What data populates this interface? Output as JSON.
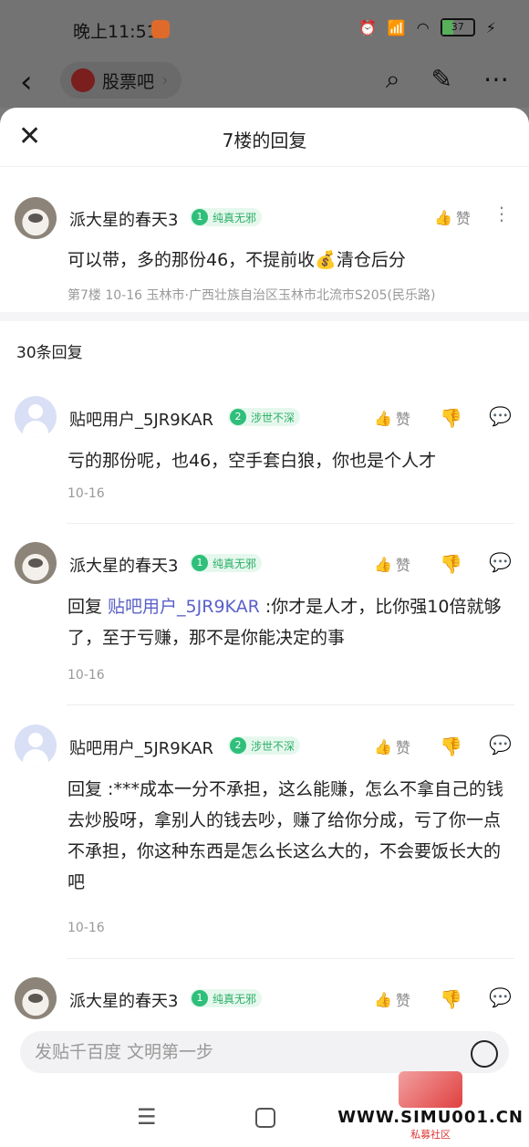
{
  "status": {
    "time": "晚上11:51",
    "battery": "37"
  },
  "nav": {
    "forum": "股票吧"
  },
  "sheet": {
    "title": "7楼的回复"
  },
  "floor": {
    "user": "派大星的春天3",
    "level": "1",
    "badge": "纯真无邪",
    "content": "可以带，多的那份46，不提前收💰清仓后分",
    "meta": "第7楼   10-16   玉林市·广西壮族自治区玉林市北流市S205(民乐路)",
    "like_label": "赞"
  },
  "reply_count": "30条回复",
  "replies": [
    {
      "user": "贴吧用户_5JR9KAR",
      "level": "2",
      "badge": "涉世不深",
      "content": "亏的那份呢，也46，空手套白狼，你也是个人才",
      "date": "10-16",
      "like_label": "赞"
    },
    {
      "user": "派大星的春天3",
      "level": "1",
      "badge": "纯真无邪",
      "prefix": "回复 ",
      "mention": "贴吧用户_5JR9KAR",
      "content": " :你才是人才，比你强10倍就够了，至于亏赚，那不是你能决定的事",
      "date": "10-16",
      "like_label": "赞"
    },
    {
      "user": "贴吧用户_5JR9KAR",
      "level": "2",
      "badge": "涉世不深",
      "content": "回复   :***成本一分不承担，这么能赚，怎么不拿自己的钱去炒股呀，拿别人的钱去吵，赚了给你分成，亏了你一点不承担，你这种东西是怎么长这么大的，不会要饭长大的吧",
      "date": "10-16",
      "like_label": "赞"
    },
    {
      "user": "派大星的春天3",
      "level": "1",
      "badge": "纯真无邪",
      "like_label": "赞"
    }
  ],
  "input": {
    "placeholder": "发贴千百度 文明第一步"
  },
  "watermark": {
    "site": "WWW.SIMU001.CN",
    "sub": "私募社区"
  }
}
